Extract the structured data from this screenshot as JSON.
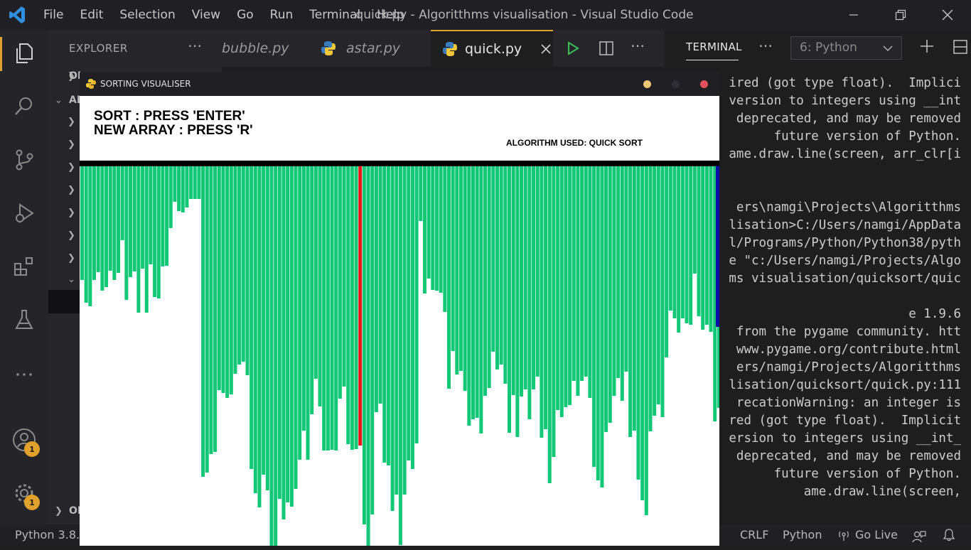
{
  "window": {
    "title": "quick.py - Algoritthms visualisation - Visual Studio Code",
    "menu": [
      "File",
      "Edit",
      "Selection",
      "View",
      "Go",
      "Run",
      "Terminal",
      "Help"
    ],
    "controls": [
      "minimize-icon",
      "restore-icon",
      "close-icon"
    ]
  },
  "activity": {
    "icons": [
      "files-icon",
      "search-icon",
      "source-control-icon",
      "run-debug-icon",
      "extensions-icon",
      "testing-icon",
      "more-icon",
      "account-icon",
      "settings-gear-icon"
    ],
    "account_badge": "1",
    "settings_badge": "1"
  },
  "sidebar": {
    "title": "EXPLORER",
    "sections": [
      "OI",
      "AL",
      "OI"
    ]
  },
  "tabs": [
    {
      "label": "bubble.py"
    },
    {
      "label": "astar.py"
    },
    {
      "label": "quick.py",
      "active": true
    }
  ],
  "terminal": {
    "tab_label": "TERMINAL",
    "select_value": "6: Python",
    "lines": [
      "ired (got type float).  Implici",
      "version to integers using __int",
      "deprecated, and may be removed",
      " future version of Python.",
      "ame.draw.line(screen, arr_clr[i",
      "",
      "",
      "ers\\namgi\\Projects\\Algoritthms",
      "lisation>C:/Users/namgi/AppData",
      "l/Programs/Python/Python38/pyth",
      "e \"c:/Users/namgi/Projects/Algo",
      "ms visualisation/quicksort/quic",
      "",
      "e 1.9.6",
      " from the pygame community. htt",
      "www.pygame.org/contribute.html",
      "ers/namgi/Projects/Algoritthms",
      "lisation/quicksort/quick.py:111",
      "recationWarning: an integer is",
      "red (got type float).  Implicit",
      "ersion to integers using __int_",
      "deprecated, and may be removed",
      "future version of Python.",
      "ame.draw.line(screen,"
    ]
  },
  "statusbar": {
    "python": "Python 3.8.5",
    "eol": "CRLF",
    "language": "Python",
    "golive": "Go Live"
  },
  "pygame": {
    "title": "SORTING VISUALISER",
    "instruction_sort": "SORT : PRESS 'ENTER'",
    "instruction_new": "NEW ARRAY : PRESS 'R'",
    "algorithm": "ALGORITHM USED: QUICK SORT",
    "colors": {
      "bar": "#12c776",
      "pivot": "#e8151d",
      "current": "#0c0ca8"
    },
    "bar_lengths": [
      160,
      192,
      197,
      160,
      149,
      175,
      170,
      147,
      160,
      150,
      104,
      188,
      156,
      148,
      206,
      144,
      206,
      138,
      184,
      186,
      141,
      140,
      87,
      50,
      63,
      65,
      58,
      46,
      46,
      46,
      437,
      431,
      405,
      402,
      315,
      319,
      326,
      321,
      292,
      279,
      275,
      294,
      426,
      460,
      480,
      434,
      456,
      543,
      534,
      468,
      497,
      473,
      479,
      454,
      413,
      372,
      413,
      349,
      299,
      338,
      400,
      400,
      399,
      400,
      327,
      310,
      391,
      399,
      398,
      393,
      504,
      537,
      490,
      346,
      334,
      417,
      421,
      485,
      462,
      533,
      462,
      414,
      426,
      390,
      77,
      179,
      158,
      174,
      175,
      178,
      205,
      313,
      260,
      293,
      288,
      316,
      365,
      356,
      354,
      376,
      323,
      312,
      261,
      286,
      279,
      306,
      375,
      322,
      381,
      324,
      314,
      356,
      314,
      296,
      382,
      370,
      446,
      409,
      343,
      353,
      339,
      336,
      302,
      323,
      302,
      296,
      326,
      423,
      442,
      452,
      374,
      361,
      323,
      298,
      330,
      289,
      381,
      372,
      441,
      470,
      491,
      373,
      351,
      335,
      353,
      269,
      203,
      214,
      234,
      214,
      221,
      223,
      151,
      211,
      230,
      223,
      233,
      359,
      340,
      251,
      358,
      232,
      264,
      267,
      181,
      223,
      262,
      201,
      205
    ],
    "pivot_index": 69,
    "current_value": 226
  }
}
